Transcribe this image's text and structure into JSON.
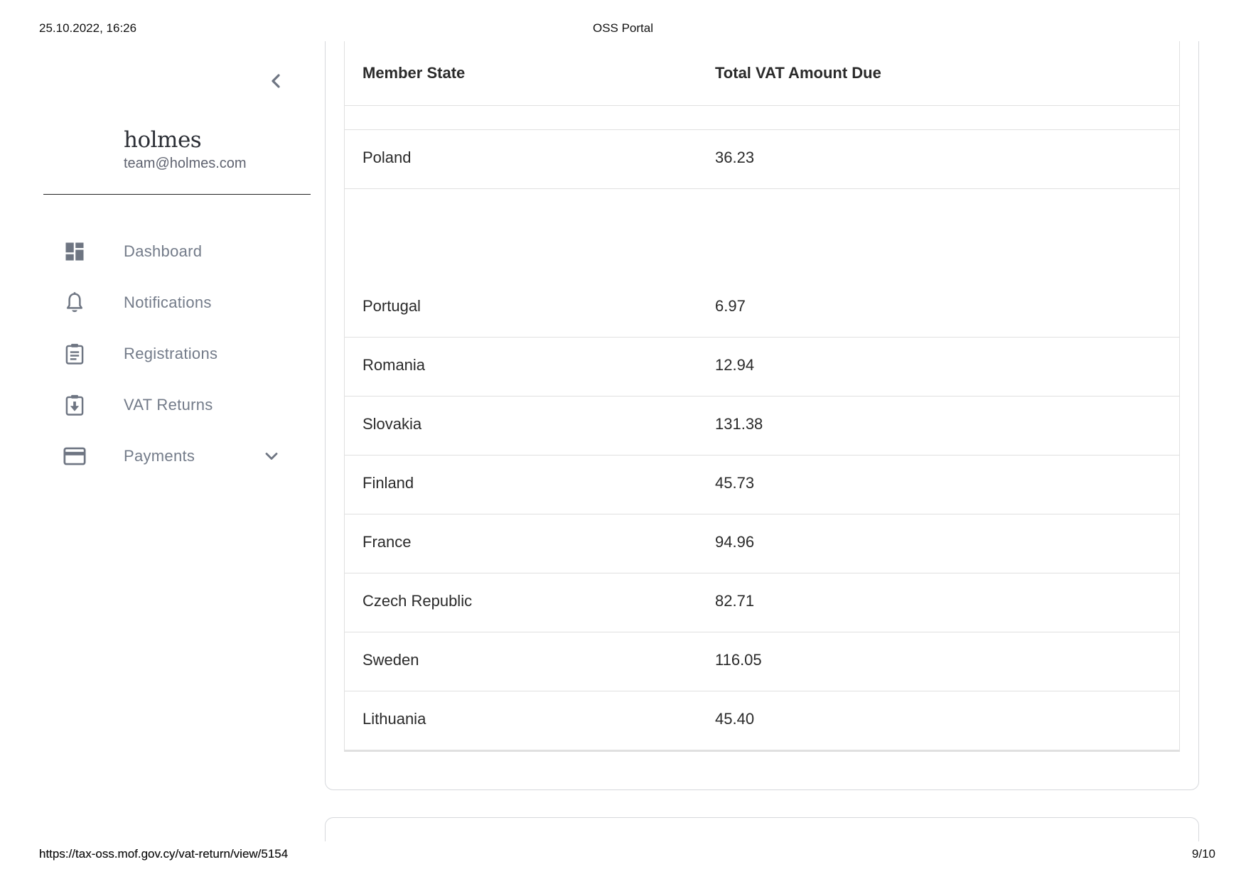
{
  "print_header": {
    "datetime": "25.10.2022, 16:26",
    "title": "OSS Portal"
  },
  "print_footer": {
    "url": "https://tax-oss.mof.gov.cy/vat-return/view/5154",
    "page": "9/10"
  },
  "sidebar": {
    "brand_name": "holmes",
    "brand_email": "team@holmes.com",
    "items": [
      {
        "label": "Dashboard",
        "icon": "dashboard-icon"
      },
      {
        "label": "Notifications",
        "icon": "bell-icon"
      },
      {
        "label": "Registrations",
        "icon": "clipboard-icon"
      },
      {
        "label": "VAT Returns",
        "icon": "clipboard-download-icon"
      },
      {
        "label": "Payments",
        "icon": "credit-card-icon"
      }
    ]
  },
  "table": {
    "headers": {
      "member_state": "Member State",
      "total_vat": "Total VAT Amount Due"
    },
    "rows": [
      {
        "state": "Poland",
        "amount": "36.23"
      },
      {
        "state": "Portugal",
        "amount": "6.97"
      },
      {
        "state": "Romania",
        "amount": "12.94"
      },
      {
        "state": "Slovakia",
        "amount": "131.38"
      },
      {
        "state": "Finland",
        "amount": "45.73"
      },
      {
        "state": "France",
        "amount": "94.96"
      },
      {
        "state": "Czech Republic",
        "amount": "82.71"
      },
      {
        "state": "Sweden",
        "amount": "116.05"
      },
      {
        "state": "Lithuania",
        "amount": "45.40"
      }
    ]
  },
  "colors": {
    "nav_text": "#737b89",
    "nav_icon": "#6e7582",
    "border": "#e0e0e0"
  }
}
